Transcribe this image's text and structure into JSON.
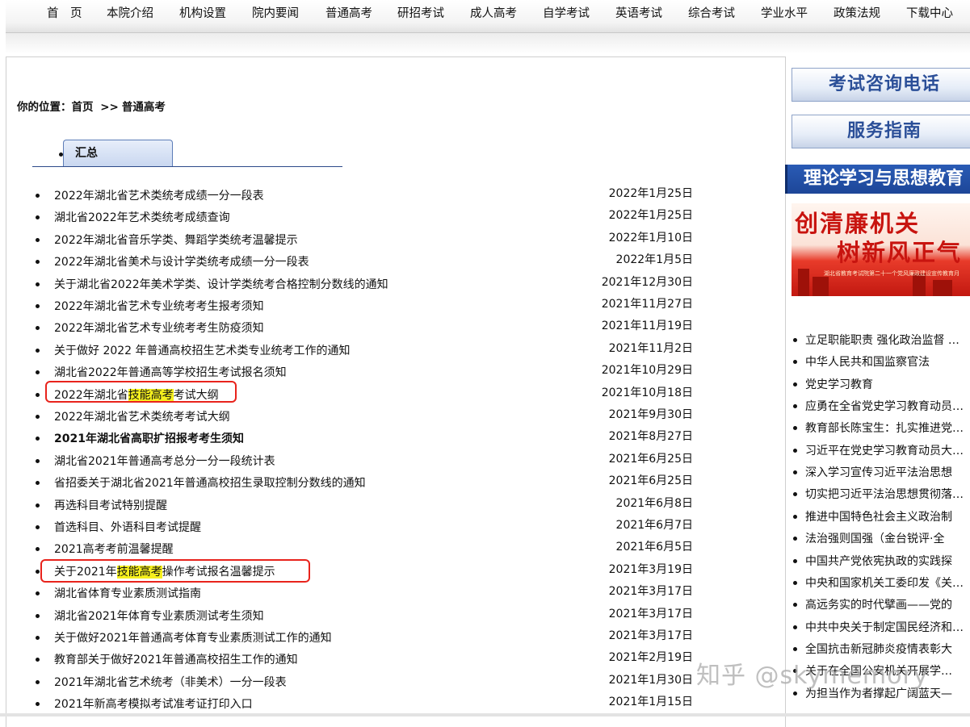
{
  "nav": [
    "首　页",
    "本院介绍",
    "机构设置",
    "院内要闻",
    "普通高考",
    "研招考试",
    "成人高考",
    "自学考试",
    "英语考试",
    "综合考试",
    "学业水平",
    "政策法规",
    "下载中心"
  ],
  "breadcrumb": {
    "label": "你的位置：",
    "home": "首页",
    "sep": ">>",
    "current": "普通高考"
  },
  "tab": {
    "label": "汇总"
  },
  "articles": [
    {
      "title": "2022年湖北省艺术类统考成绩一分一段表",
      "date": "2022年1月25日"
    },
    {
      "title": "湖北省2022年艺术类统考成绩查询",
      "date": "2022年1月25日"
    },
    {
      "title": "2022年湖北省音乐学类、舞蹈学类统考温馨提示",
      "date": "2022年1月10日"
    },
    {
      "title": "2022年湖北省美术与设计学类统考成绩一分一段表",
      "date": "2022年1月5日"
    },
    {
      "title": "关于湖北省2022年美术学类、设计学类统考合格控制分数线的通知",
      "date": "2021年12月30日"
    },
    {
      "title": "2022年湖北省艺术专业统考考生报考须知",
      "date": "2021年11月27日"
    },
    {
      "title": "2022年湖北省艺术专业统考考生防疫须知",
      "date": "2021年11月19日"
    },
    {
      "title": "关于做好 2022 年普通高校招生艺术类专业统考工作的通知",
      "date": "2021年11月2日"
    },
    {
      "title": "湖北省2022年普通高等学校招生考试报名须知",
      "date": "2021年10月29日"
    },
    {
      "title_pre": "2022年湖北省",
      "title_hl": "技能高考",
      "title_post": "考试大纲",
      "date": "2021年10月18日"
    },
    {
      "title": "2022年湖北省艺术类统考考试大纲",
      "date": "2021年9月30日"
    },
    {
      "title": "2021年湖北省高职扩招报考考生须知",
      "date": "2021年8月27日"
    },
    {
      "title": "湖北省2021年普通高考总分一分一段统计表",
      "date": "2021年6月25日"
    },
    {
      "title": "省招委关于湖北省2021年普通高校招生录取控制分数线的通知",
      "date": "2021年6月25日"
    },
    {
      "title": "再选科目考试特别提醒",
      "date": "2021年6月8日"
    },
    {
      "title": "首选科目、外语科目考试提醒",
      "date": "2021年6月7日"
    },
    {
      "title": "2021高考考前温馨提醒",
      "date": "2021年6月5日"
    },
    {
      "title_pre": "关于2021年",
      "title_hl": "技能高考",
      "title_post": "操作考试报名温馨提示",
      "date": "2021年3月19日"
    },
    {
      "title": "湖北省体育专业素质测试指南",
      "date": "2021年3月17日"
    },
    {
      "title": "湖北省2021年体育专业素质测试考生须知",
      "date": "2021年3月17日"
    },
    {
      "title": "关于做好2021年普通高考体育专业素质测试工作的通知",
      "date": "2021年3月17日"
    },
    {
      "title": "教育部关于做好2021年普通高校招生工作的通知",
      "date": "2021年2月19日"
    },
    {
      "title": "2021年湖北省艺术统考（非美术）一分一段表",
      "date": "2021年1月30日"
    },
    {
      "title": "2021年新高考模拟考试准考证打印入口",
      "date": "2021年1月15日"
    }
  ],
  "sidebar": {
    "consult": "考试咨询电话",
    "guide": "服务指南",
    "theory": "理论学习与思想教育",
    "banner_line1": "创清廉机关",
    "banner_line2": "树新风正气",
    "banner_caption": "湖北省教育考试院第二十一个党风廉政建设宣传教育月",
    "items": [
      "立足职能职责 强化政治监督 …",
      "中华人民共和国监察官法",
      "党史学习教育",
      "应勇在全省党史学习教育动员…",
      "教育部长陈宝生：扎实推进党…",
      "习近平在党史学习教育动员大…",
      "深入学习宣传习近平法治思想",
      "切实把习近平法治思想贯彻落…",
      "推进中国特色社会主义政治制",
      "法治强则国强（金台锐评·全",
      "中国共产党依宪执政的实践探",
      "中央和国家机关工委印发《关…",
      "高远务实的时代擘画——党的",
      "中共中央关于制定国民经济和…",
      "全国抗击新冠肺炎疫情表彰大",
      "关于在全国公安机关开展学…",
      "为担当作为者撑起广阔蓝天—"
    ]
  },
  "watermark": "知乎 @skymemory"
}
